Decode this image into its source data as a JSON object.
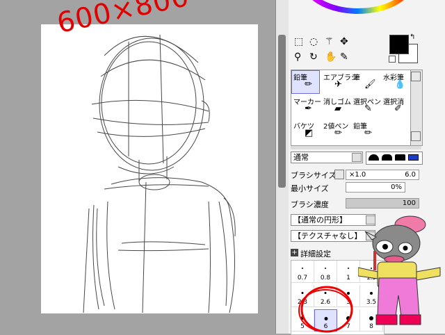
{
  "annotation": {
    "size_note": "600×800"
  },
  "toolbar": {
    "tool_icons": [
      "rect-select-icon",
      "lasso-select-icon",
      "magic-wand-icon",
      "move-icon",
      "zoom-icon",
      "rotate-icon",
      "hand-icon",
      "eyedropper-icon"
    ],
    "primary_color": "#000000",
    "secondary_color": "#ffffff"
  },
  "tools": [
    {
      "label": "鉛筆",
      "icon": "pencil-icon",
      "selected": true
    },
    {
      "label": "エアブラシ",
      "icon": "airbrush-icon",
      "selected": false
    },
    {
      "label": "筆",
      "icon": "brush-icon",
      "selected": false
    },
    {
      "label": "水彩筆",
      "icon": "watercolor-icon",
      "selected": false
    },
    {
      "label": "マーカー",
      "icon": "marker-icon",
      "selected": false
    },
    {
      "label": "消しゴム",
      "icon": "eraser-icon",
      "selected": false
    },
    {
      "label": "選択ペン",
      "icon": "select-pen-icon",
      "selected": false
    },
    {
      "label": "選択消",
      "icon": "select-eraser-icon",
      "selected": false
    },
    {
      "label": "バケツ",
      "icon": "bucket-icon",
      "selected": false
    },
    {
      "label": "2値ペン",
      "icon": "binary-pen-icon",
      "selected": false
    },
    {
      "label": "鉛筆",
      "icon": "pencil-icon",
      "selected": false
    }
  ],
  "blend": {
    "mode_label": "通常",
    "shapes": [
      "soft-shape-icon",
      "medium-shape-icon",
      "hard-shape-icon",
      "square-shape-icon"
    ]
  },
  "brush": {
    "size_label": "ブラシサイズ",
    "size_mult": "×1.0",
    "size_value": "6.0",
    "min_size_label": "最小サイズ",
    "min_size_value": "0%",
    "density_label": "ブラシ濃度",
    "density_value": "100",
    "density_fraction": 1.0,
    "shape_label": "【通常の円形】",
    "texture_label": "【テクスチャなし】",
    "advanced_label": "詳細設定"
  },
  "size_presets": [
    {
      "value": "0.7",
      "dot": 1
    },
    {
      "value": "0.8",
      "dot": 1
    },
    {
      "value": "1",
      "dot": 1
    },
    {
      "value": "1.5",
      "dot": 1
    },
    {
      "value": "2.3",
      "dot": 2
    },
    {
      "value": "2.6",
      "dot": 2
    },
    {
      "value": "3",
      "dot": 3
    },
    {
      "value": "3.5",
      "dot": 3
    },
    {
      "value": "5",
      "dot": 4,
      "selected": false
    },
    {
      "value": "6",
      "dot": 4,
      "selected": true
    },
    {
      "value": "7",
      "dot": 5
    },
    {
      "value": "8",
      "dot": 5
    }
  ]
}
